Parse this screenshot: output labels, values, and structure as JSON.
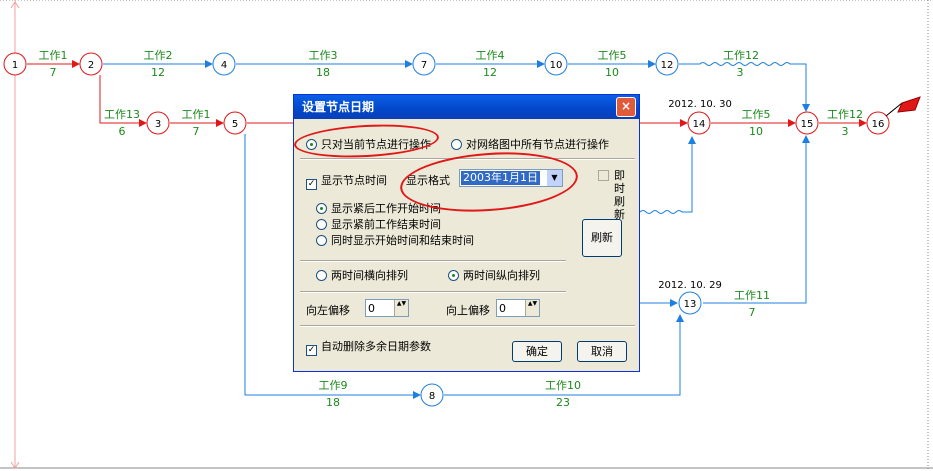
{
  "network": {
    "tasks": [
      {
        "label": "工作1",
        "duration": "7"
      },
      {
        "label": "工作2",
        "duration": "12"
      },
      {
        "label": "工作3",
        "duration": "18"
      },
      {
        "label": "工作4",
        "duration": "12"
      },
      {
        "label": "工作5",
        "duration": "10"
      },
      {
        "label": "工作12",
        "duration": "3"
      },
      {
        "label": "工作13",
        "duration": "6"
      },
      {
        "label": "工作1",
        "duration": "7"
      },
      {
        "label": "工作5",
        "duration": "10"
      },
      {
        "label": "工作12",
        "duration": "3"
      },
      {
        "label": "工作11",
        "duration": "7"
      },
      {
        "label": "工作9",
        "duration": "18"
      },
      {
        "label": "工作10",
        "duration": "23"
      }
    ],
    "nodes": [
      "1",
      "2",
      "3",
      "4",
      "5",
      "7",
      "8",
      "10",
      "12",
      "13",
      "14",
      "15",
      "16"
    ],
    "dates": {
      "node14": "2012. 10. 30",
      "node13": "2012. 10. 29"
    },
    "colors": {
      "critical": "#e01818",
      "normal": "#1e7fe0",
      "labels": "#1a8a1a"
    }
  },
  "dialog": {
    "title": "设置节点日期",
    "close_icon": "×",
    "scope_current": "只对当前节点进行操作",
    "scope_all": "对网络图中所有节点进行操作",
    "show_time": "显示节点时间",
    "format_label": "显示格式",
    "format_value": "2003年1月1日",
    "instant_refresh": "即时刷新",
    "opt_start": "显示紧后工作开始时间",
    "opt_end": "显示紧前工作结束时间",
    "opt_both": "同时显示开始时间和结束时间",
    "layout_h": "两时间横向排列",
    "layout_v": "两时间纵向排列",
    "left_offset_label": "向左偏移",
    "left_offset_value": "0",
    "up_offset_label": "向上偏移",
    "up_offset_value": "0",
    "auto_delete": "自动删除多余日期参数",
    "refresh_btn": "刷新",
    "ok_btn": "确定",
    "cancel_btn": "取消",
    "checked_mark": "✓",
    "spin_arrows": "▲▼"
  }
}
